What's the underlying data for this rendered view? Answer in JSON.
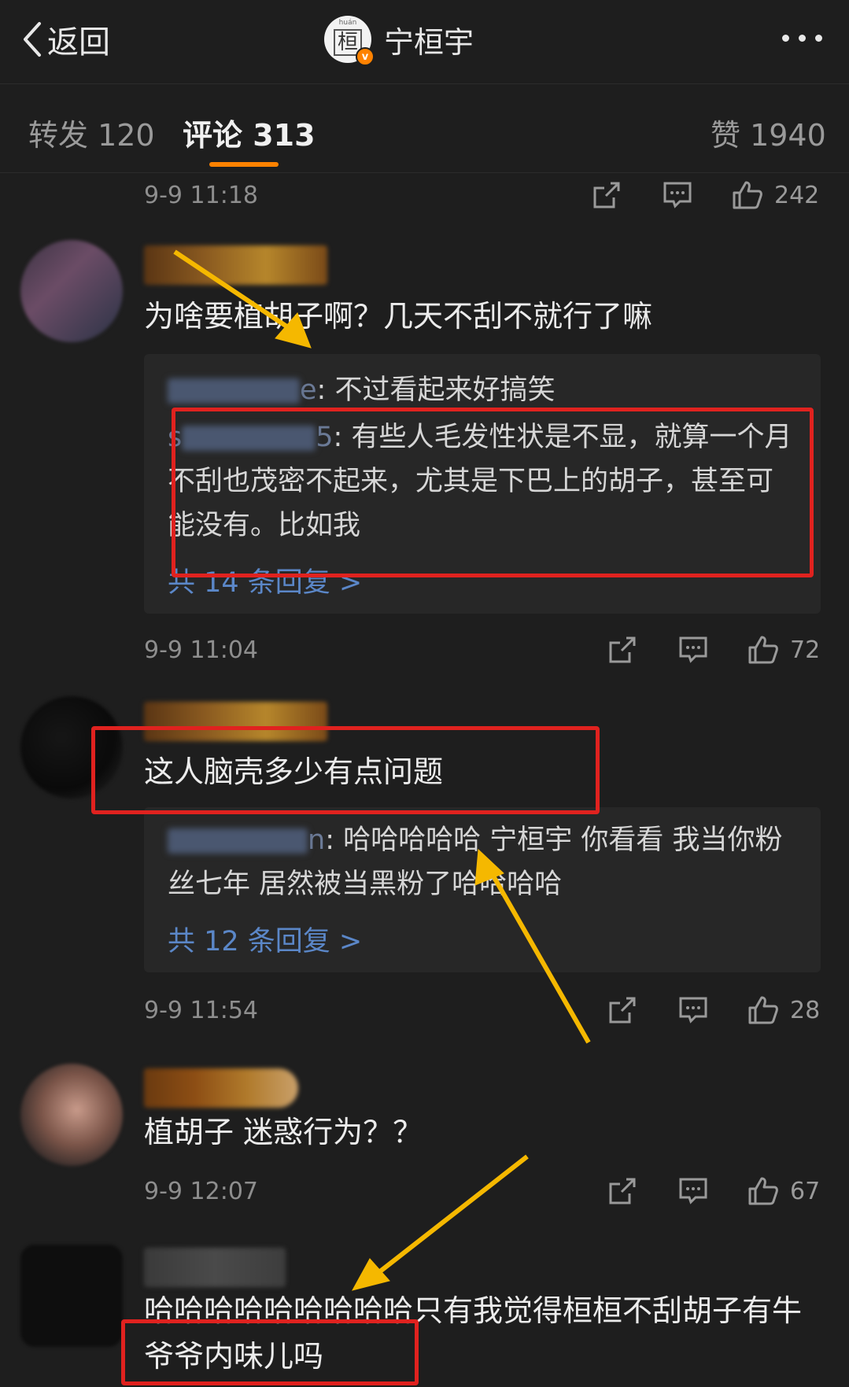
{
  "header": {
    "back_label": "返回",
    "avatar_glyph": "桓",
    "avatar_pinyin": "huán",
    "avatar_badge": "v",
    "title": "宁桓宇"
  },
  "tabs": [
    {
      "label": "转发 120"
    },
    {
      "label": "评论 313"
    },
    {
      "label": "赞 1940"
    }
  ],
  "comments": [
    {
      "time": "9-9 11:18",
      "likes": "242"
    },
    {
      "text": "为啥要植胡子啊？几天不刮不就行了嘛",
      "replies": [
        {
          "name_suffix": "e",
          "text": ": 不过看起来好搞笑"
        },
        {
          "name_prefix": "s",
          "name_suffix": "5",
          "text": ": 有些人毛发性状是不显，就算一个月不刮也茂密不起来，尤其是下巴上的胡子，甚至可能没有。比如我"
        }
      ],
      "reply_count": "共 14 条回复 >",
      "time": "9-9 11:04",
      "likes": "72"
    },
    {
      "text": "这人脑壳多少有点问题",
      "replies": [
        {
          "name_suffix": "n",
          "text": ": 哈哈哈哈哈 宁桓宇 你看看 我当你粉丝七年 居然被当黑粉了哈哈哈哈"
        }
      ],
      "reply_count": "共 12 条回复 >",
      "time": "9-9 11:54",
      "likes": "28"
    },
    {
      "text": "植胡子 迷惑行为？？",
      "time": "9-9 12:07",
      "likes": "67"
    },
    {
      "text": "哈哈哈哈哈哈哈哈哈只有我觉得桓桓不刮胡子有牛爷爷内味儿吗"
    }
  ],
  "colors": {
    "accent": "#ff8200",
    "link": "#5b87c8",
    "annotation_box": "#e0221f",
    "annotation_arrow": "#f5b800"
  }
}
